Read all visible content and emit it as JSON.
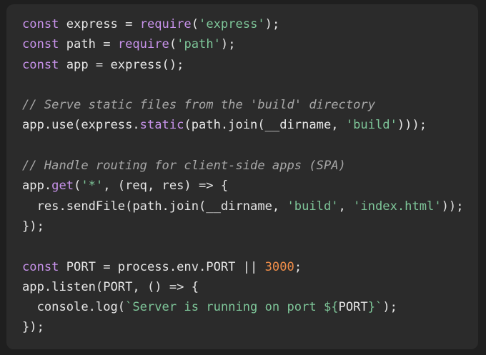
{
  "colors": {
    "background": "#2b2b2b",
    "plain": "#e6e6e6",
    "keyword": "#c792ea",
    "string": "#7ec699",
    "number": "#f08d49",
    "comment": "#a7a7a7"
  },
  "code": {
    "language": "javascript",
    "lines": [
      [
        {
          "t": "kw",
          "v": "const"
        },
        {
          "t": "plain",
          "v": " express = "
        },
        {
          "t": "fn",
          "v": "require"
        },
        {
          "t": "plain",
          "v": "("
        },
        {
          "t": "str",
          "v": "'express'"
        },
        {
          "t": "plain",
          "v": ");"
        }
      ],
      [
        {
          "t": "kw",
          "v": "const"
        },
        {
          "t": "plain",
          "v": " path = "
        },
        {
          "t": "fn",
          "v": "require"
        },
        {
          "t": "plain",
          "v": "("
        },
        {
          "t": "str",
          "v": "'path'"
        },
        {
          "t": "plain",
          "v": ");"
        }
      ],
      [
        {
          "t": "kw",
          "v": "const"
        },
        {
          "t": "plain",
          "v": " app = express();"
        }
      ],
      [],
      [
        {
          "t": "cm",
          "v": "// Serve static files from the 'build' directory"
        }
      ],
      [
        {
          "t": "plain",
          "v": "app.use(express."
        },
        {
          "t": "fn",
          "v": "static"
        },
        {
          "t": "plain",
          "v": "(path.join(__dirname, "
        },
        {
          "t": "str",
          "v": "'build'"
        },
        {
          "t": "plain",
          "v": ")));"
        }
      ],
      [],
      [
        {
          "t": "cm",
          "v": "// Handle routing for client-side apps (SPA)"
        }
      ],
      [
        {
          "t": "plain",
          "v": "app."
        },
        {
          "t": "fn",
          "v": "get"
        },
        {
          "t": "plain",
          "v": "("
        },
        {
          "t": "str",
          "v": "'*'"
        },
        {
          "t": "plain",
          "v": ", (req, res) => {"
        }
      ],
      [
        {
          "t": "plain",
          "v": "  res.sendFile(path.join(__dirname, "
        },
        {
          "t": "str",
          "v": "'build'"
        },
        {
          "t": "plain",
          "v": ", "
        },
        {
          "t": "str",
          "v": "'index.html'"
        },
        {
          "t": "plain",
          "v": "));"
        }
      ],
      [
        {
          "t": "plain",
          "v": "});"
        }
      ],
      [],
      [
        {
          "t": "kw",
          "v": "const"
        },
        {
          "t": "plain",
          "v": " PORT = process.env.PORT || "
        },
        {
          "t": "num",
          "v": "3000"
        },
        {
          "t": "plain",
          "v": ";"
        }
      ],
      [
        {
          "t": "plain",
          "v": "app.listen(PORT, () => {"
        }
      ],
      [
        {
          "t": "plain",
          "v": "  console.log("
        },
        {
          "t": "str",
          "v": "`Server is running on port ${"
        },
        {
          "t": "plain",
          "v": "PORT"
        },
        {
          "t": "str",
          "v": "}`"
        },
        {
          "t": "plain",
          "v": ");"
        }
      ],
      [
        {
          "t": "plain",
          "v": "});"
        }
      ]
    ]
  }
}
